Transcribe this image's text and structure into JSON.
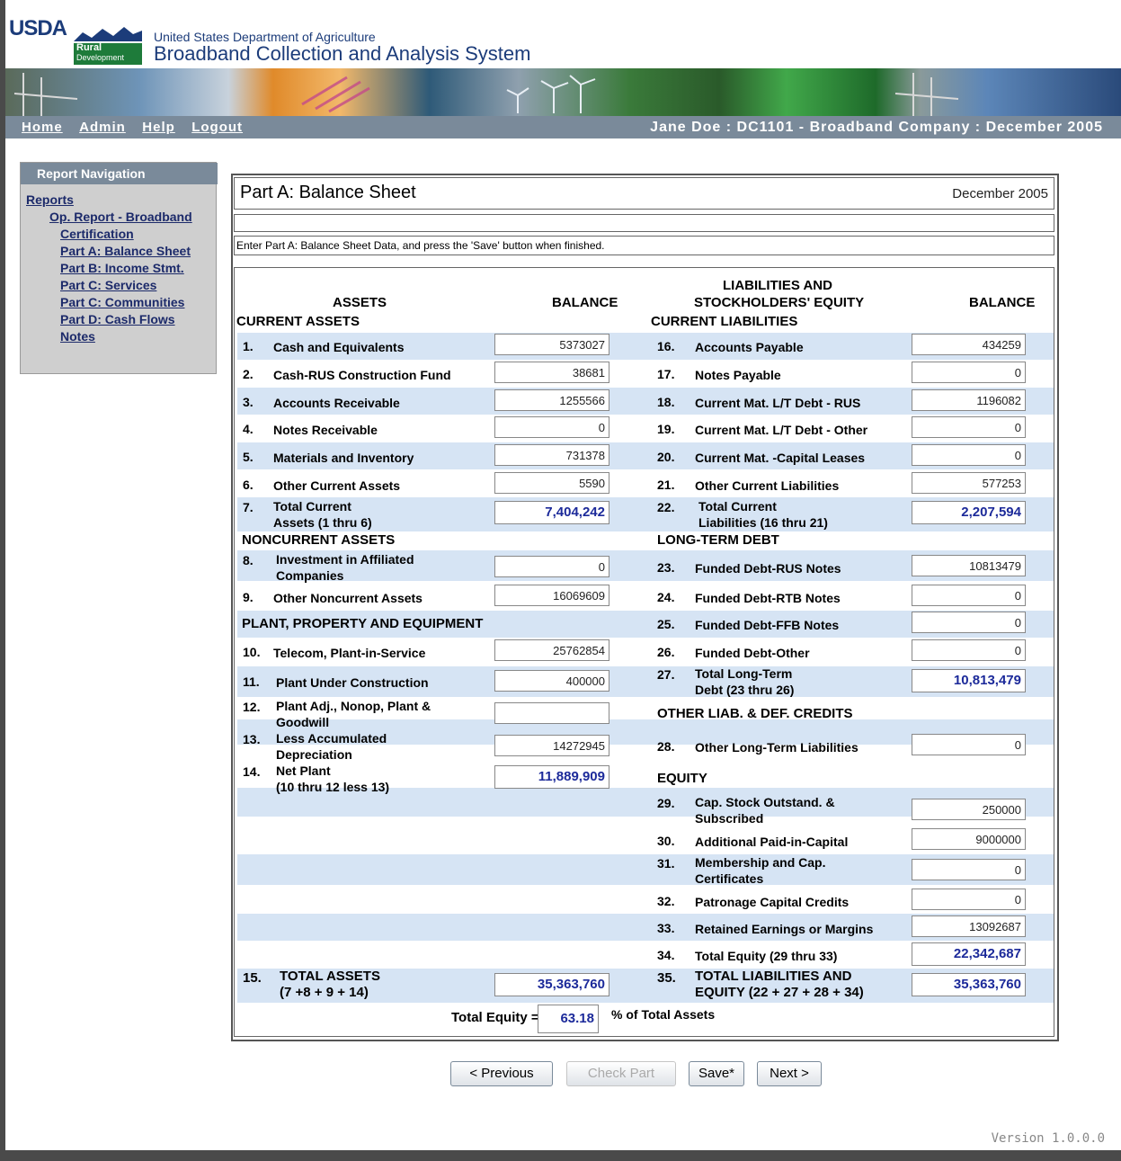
{
  "header": {
    "logo_text": "USDA",
    "logo_sub1": "Rural",
    "logo_sub2": "Development",
    "department": "United States Department of Agriculture",
    "system_title": "Broadband Collection and Analysis System"
  },
  "top_nav": {
    "home": "Home",
    "admin": "Admin",
    "help": "Help",
    "logout": "Logout",
    "user_info": "Jane Doe : DC1101 - Broadband Company : December 2005"
  },
  "side_nav": {
    "title": "Report Navigation",
    "items": [
      "Reports",
      "Op. Report - Broadband",
      "Certification",
      "Part A: Balance Sheet",
      "Part B: Income Stmt.",
      "Part C: Services",
      "Part C: Communities",
      "Part D: Cash Flows",
      "Notes"
    ]
  },
  "page": {
    "title": "Part A: Balance Sheet",
    "date": "December 2005",
    "instructions": "Enter Part A: Balance Sheet Data, and press the 'Save' button when finished."
  },
  "headers": {
    "assets": "ASSETS",
    "balance": "BALANCE",
    "liab_line1": "LIABILITIES AND",
    "liab_line2": "STOCKHOLDERS' EQUITY",
    "current_assets": "CURRENT ASSETS",
    "current_liabilities": "CURRENT LIABILITIES",
    "noncurrent_assets": "NONCURRENT ASSETS",
    "long_term_debt": "LONG-TERM DEBT",
    "ppe": "PLANT, PROPERTY AND EQUIPMENT",
    "other_liab": "OTHER LIAB. & DEF. CREDITS",
    "equity": "EQUITY"
  },
  "left_rows": [
    {
      "num": "1.",
      "label": "Cash and Equivalents",
      "value": "5373027"
    },
    {
      "num": "2.",
      "label": "Cash-RUS Construction Fund",
      "value": "38681"
    },
    {
      "num": "3.",
      "label": "Accounts Receivable",
      "value": "1255566"
    },
    {
      "num": "4.",
      "label": "Notes Receivable",
      "value": "0"
    },
    {
      "num": "5.",
      "label": "Materials and Inventory",
      "value": "731378"
    },
    {
      "num": "6.",
      "label": "Other Current Assets",
      "value": "5590"
    },
    {
      "num": "7.",
      "label": "Total Current\nAssets (1 thru 6)",
      "value": "7,404,242"
    },
    {
      "num": "8.",
      "label": "Investment in Affiliated\nCompanies",
      "value": "0"
    },
    {
      "num": "9.",
      "label": "Other Noncurrent Assets",
      "value": "16069609"
    },
    {
      "num": "10.",
      "label": "Telecom, Plant-in-Service",
      "value": "25762854"
    },
    {
      "num": "11.",
      "label": "Plant Under Construction",
      "value": "400000"
    },
    {
      "num": "12.",
      "label": "Plant Adj., Nonop, Plant &\nGoodwill",
      "value": ""
    },
    {
      "num": "13.",
      "label": "Less Accumulated\nDepreciation",
      "value": "14272945"
    },
    {
      "num": "14.",
      "label": "Net Plant\n(10 thru 12 less 13)",
      "value": "11,889,909"
    },
    {
      "num": "15.",
      "label": "TOTAL ASSETS\n(7 +8 + 9 + 14)",
      "value": "35,363,760"
    }
  ],
  "right_rows": [
    {
      "num": "16.",
      "label": "Accounts Payable",
      "value": "434259"
    },
    {
      "num": "17.",
      "label": "Notes Payable",
      "value": "0"
    },
    {
      "num": "18.",
      "label": "Current Mat. L/T Debt - RUS",
      "value": "1196082"
    },
    {
      "num": "19.",
      "label": "Current Mat. L/T Debt - Other",
      "value": "0"
    },
    {
      "num": "20.",
      "label": "Current Mat. -Capital Leases",
      "value": "0"
    },
    {
      "num": "21.",
      "label": "Other Current Liabilities",
      "value": "577253"
    },
    {
      "num": "22.",
      "label": "Total Current\nLiabilities (16 thru 21)",
      "value": "2,207,594"
    },
    {
      "num": "23.",
      "label": "Funded Debt-RUS Notes",
      "value": "10813479"
    },
    {
      "num": "24.",
      "label": "Funded Debt-RTB Notes",
      "value": "0"
    },
    {
      "num": "25.",
      "label": "Funded Debt-FFB Notes",
      "value": "0"
    },
    {
      "num": "26.",
      "label": "Funded Debt-Other",
      "value": "0"
    },
    {
      "num": "27.",
      "label": "Total Long-Term\nDebt (23 thru 26)",
      "value": "10,813,479"
    },
    {
      "num": "28.",
      "label": "Other Long-Term Liabilities",
      "value": "0"
    },
    {
      "num": "29.",
      "label": "Cap. Stock Outstand. &\nSubscribed",
      "value": "250000"
    },
    {
      "num": "30.",
      "label": "Additional Paid-in-Capital",
      "value": "9000000"
    },
    {
      "num": "31.",
      "label": "Membership and Cap.\nCertificates",
      "value": "0"
    },
    {
      "num": "32.",
      "label": "Patronage Capital Credits",
      "value": "0"
    },
    {
      "num": "33.",
      "label": "Retained Earnings or Margins",
      "value": "13092687"
    },
    {
      "num": "34.",
      "label": "Total Equity (29 thru 33)",
      "value": "22,342,687"
    },
    {
      "num": "35.",
      "label": "TOTAL LIABILITIES AND\nEQUITY (22 + 27 + 28 + 34)",
      "value": "35,363,760"
    }
  ],
  "footer_ratio": {
    "label": "Total Equity =",
    "value": "63.18",
    "suffix": "% of Total Assets"
  },
  "buttons": {
    "previous": "< Previous",
    "check": "Check Part",
    "save": "Save*",
    "next": "Next >"
  },
  "version": "Version 1.0.0.0"
}
